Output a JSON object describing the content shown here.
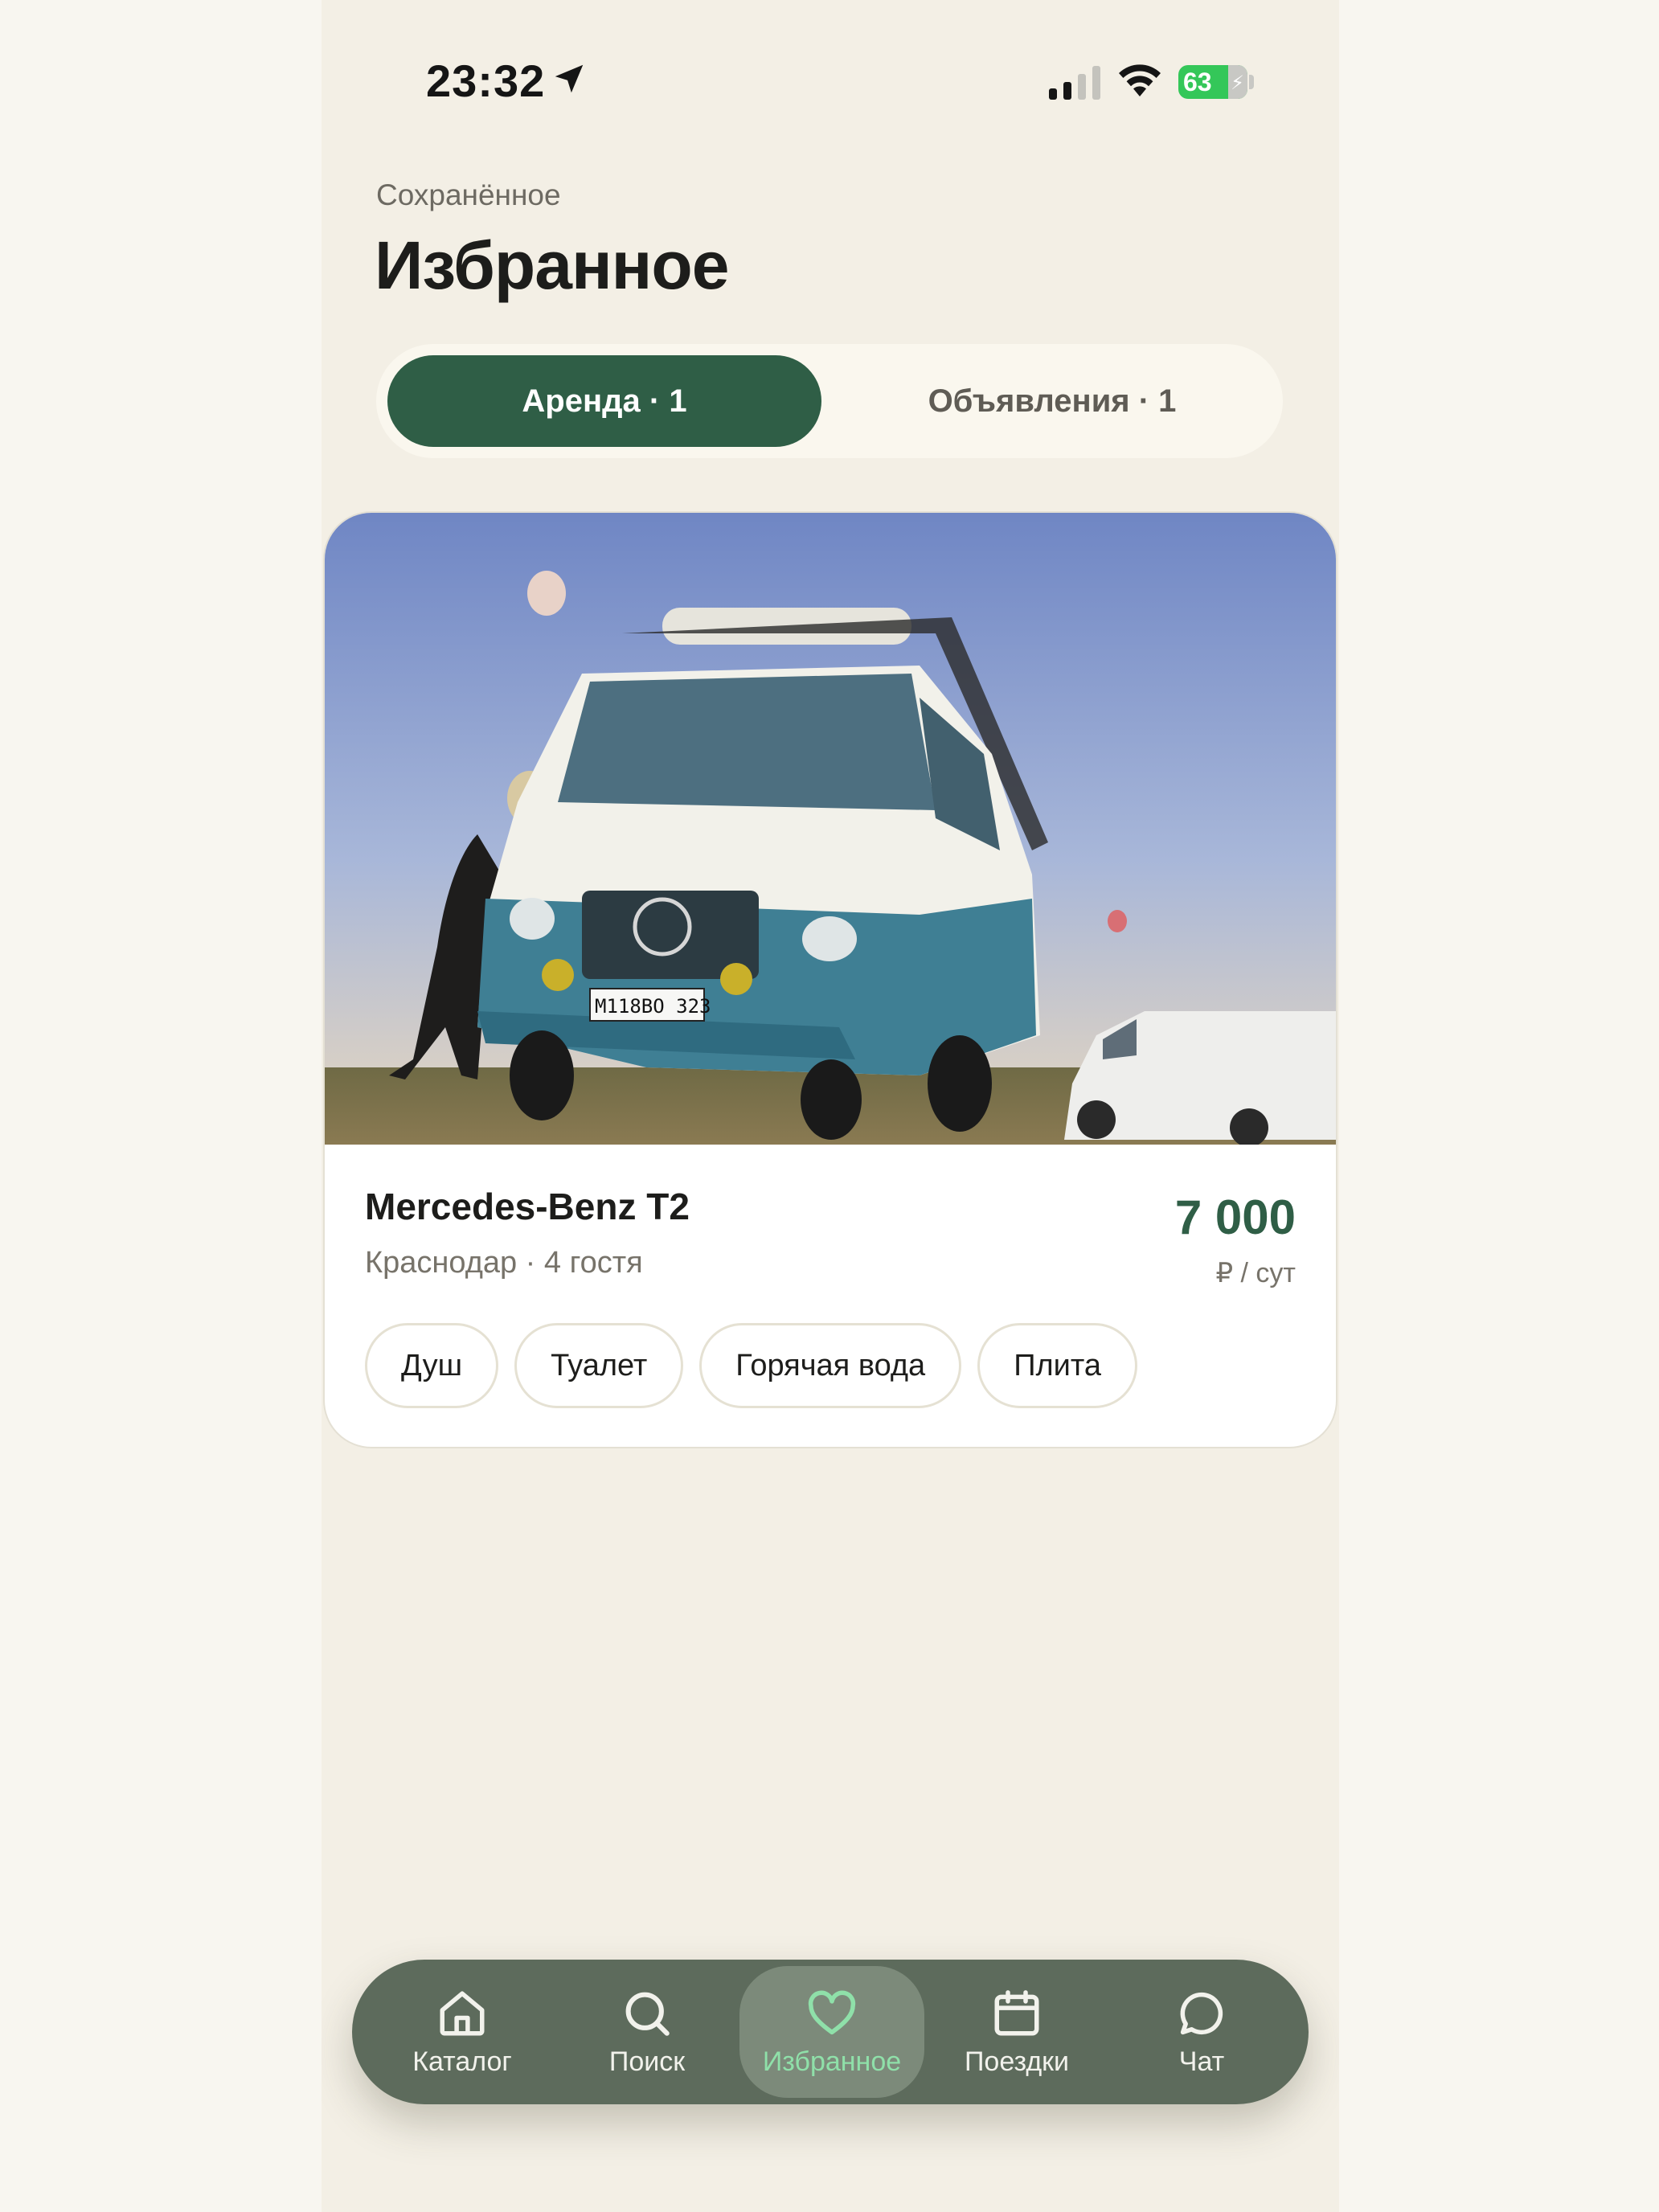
{
  "status_bar": {
    "time": "23:32",
    "battery": "63",
    "icons": [
      "location-arrow-icon",
      "signal-icon",
      "wifi-icon",
      "battery-charging-icon"
    ]
  },
  "header": {
    "subtitle": "Сохранённое",
    "title": "Избранное"
  },
  "segment": {
    "active_label": "Аренда · 1",
    "inactive_label": "Объявления · 1"
  },
  "listing": {
    "title": "Mercedes-Benz T2",
    "meta": "Краснодар · 4 гостя",
    "price": "7 000",
    "price_unit": "₽ / сут",
    "plate": "М118ВО 323",
    "amenities": [
      "Душ",
      "Туалет",
      "Горячая вода",
      "Плита"
    ]
  },
  "tabbar": {
    "items": [
      {
        "label": "Каталог",
        "icon": "home-icon"
      },
      {
        "label": "Поиск",
        "icon": "search-icon"
      },
      {
        "label": "Избранное",
        "icon": "heart-icon",
        "active": true
      },
      {
        "label": "Поездки",
        "icon": "calendar-icon"
      },
      {
        "label": "Чат",
        "icon": "chat-icon"
      }
    ]
  },
  "colors": {
    "background": "#f3efe5",
    "accent": "#2f5e46",
    "tabbar": "#5d6b5c",
    "active_tab_text": "#8fe0a9",
    "battery": "#34c759"
  }
}
